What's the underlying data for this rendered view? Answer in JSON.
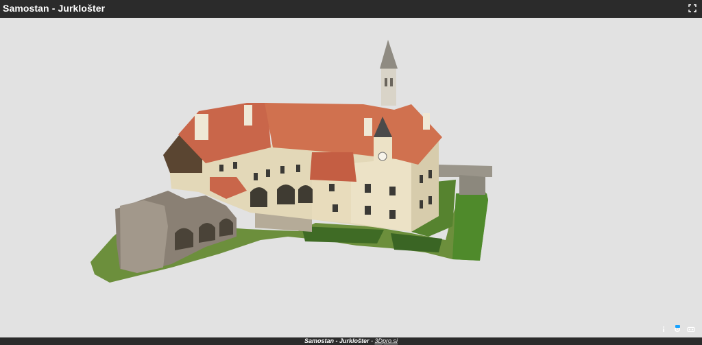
{
  "window": {
    "title": "Samostan - Jurklošter"
  },
  "footer": {
    "title": "Samostan - Jurklošter",
    "separator": " - ",
    "link_text": "3Dpro.si"
  },
  "icons": {
    "fullscreen": "fullscreen-icon",
    "info": "info-icon",
    "settings": "settings-icon",
    "vr": "vr-headset-icon"
  },
  "colors": {
    "topbar": "#2b2b2b",
    "viewer_background": "#e2e2e2",
    "accent": "#1aa3ff"
  }
}
